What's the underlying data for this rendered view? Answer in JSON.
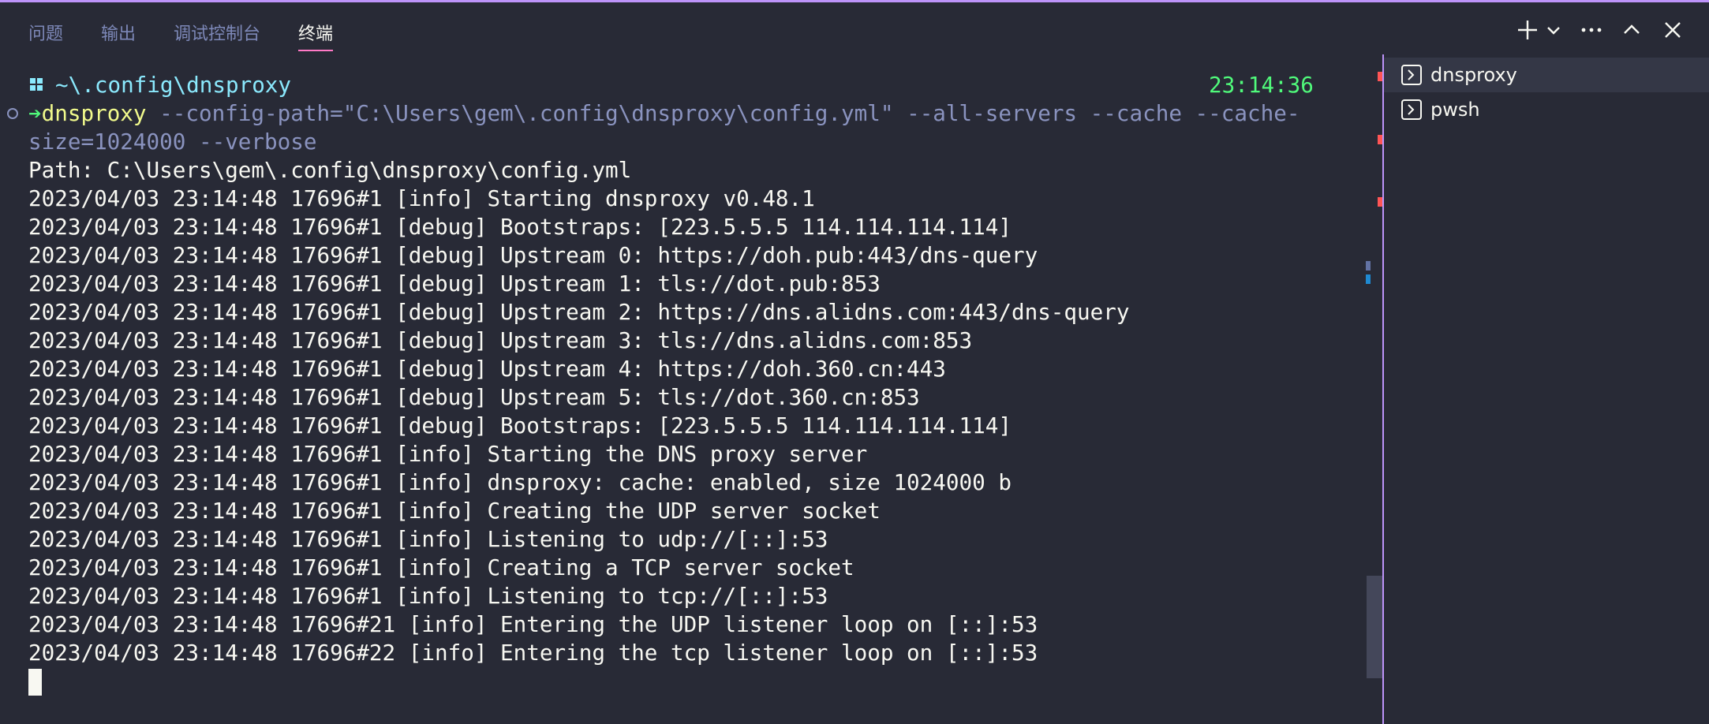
{
  "tabs": [
    {
      "label": "问题"
    },
    {
      "label": "输出"
    },
    {
      "label": "调试控制台"
    },
    {
      "label": "终端",
      "active": true
    }
  ],
  "toolbar_icons": [
    "plus-icon",
    "chevron-down-icon",
    "more-icon",
    "chevron-up-icon",
    "close-icon"
  ],
  "prompt": {
    "dir": "~\\.config\\dnsproxy",
    "time": "23:14:36",
    "arrow": "➔"
  },
  "command": {
    "name": "dnsproxy",
    "args_line1": " --config-path=\"C:\\Users\\gem\\.config\\dnsproxy\\config.yml\" --all-servers --cache --cache-",
    "args_line2": "size=1024000 --verbose"
  },
  "output": [
    "Path: C:\\Users\\gem\\.config\\dnsproxy\\config.yml",
    "2023/04/03 23:14:48 17696#1 [info] Starting dnsproxy v0.48.1",
    "2023/04/03 23:14:48 17696#1 [debug] Bootstraps: [223.5.5.5 114.114.114.114]",
    "2023/04/03 23:14:48 17696#1 [debug] Upstream 0: https://doh.pub:443/dns-query",
    "2023/04/03 23:14:48 17696#1 [debug] Upstream 1: tls://dot.pub:853",
    "2023/04/03 23:14:48 17696#1 [debug] Upstream 2: https://dns.alidns.com:443/dns-query",
    "2023/04/03 23:14:48 17696#1 [debug] Upstream 3: tls://dns.alidns.com:853",
    "2023/04/03 23:14:48 17696#1 [debug] Upstream 4: https://doh.360.cn:443",
    "2023/04/03 23:14:48 17696#1 [debug] Upstream 5: tls://dot.360.cn:853",
    "2023/04/03 23:14:48 17696#1 [debug] Bootstraps: [223.5.5.5 114.114.114.114]",
    "2023/04/03 23:14:48 17696#1 [info] Starting the DNS proxy server",
    "2023/04/03 23:14:48 17696#1 [info] dnsproxy: cache: enabled, size 1024000 b",
    "2023/04/03 23:14:48 17696#1 [info] Creating the UDP server socket",
    "2023/04/03 23:14:48 17696#1 [info] Listening to udp://[::]:53",
    "2023/04/03 23:14:48 17696#1 [info] Creating a TCP server socket",
    "2023/04/03 23:14:48 17696#1 [info] Listening to tcp://[::]:53",
    "2023/04/03 23:14:48 17696#21 [info] Entering the UDP listener loop on [::]:53",
    "2023/04/03 23:14:48 17696#22 [info] Entering the tcp listener loop on [::]:53"
  ],
  "terminal_list": [
    {
      "label": "dnsproxy",
      "icon": "terminal-icon",
      "selected": true
    },
    {
      "label": "pwsh",
      "icon": "terminal-icon",
      "selected": false
    }
  ],
  "colors": {
    "background": "#282a36",
    "foreground": "#f8f8f2",
    "accent": "#bd93f9",
    "active_tab_underline": "#ff79c6",
    "prompt_dir": "#8be9fd",
    "prompt_time": "#50fa7b",
    "command": "#f1fa8c",
    "command_args": "#8a93bf"
  }
}
